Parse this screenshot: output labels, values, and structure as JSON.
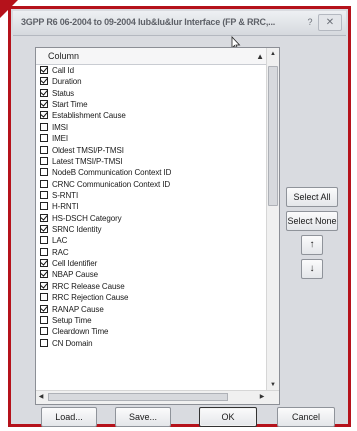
{
  "dialog": {
    "title": "3GPP R6 06-2004 to 09-2004 Iub&Iu&Iur Interface (FP & RRC,...",
    "help_label": "?",
    "close_label": "✕"
  },
  "list": {
    "column_header": "Column",
    "rows": [
      {
        "label": "Call Id",
        "checked": true
      },
      {
        "label": "Duration",
        "checked": true
      },
      {
        "label": "Status",
        "checked": true
      },
      {
        "label": "Start Time",
        "checked": true
      },
      {
        "label": "Establishment Cause",
        "checked": true
      },
      {
        "label": "IMSI",
        "checked": false
      },
      {
        "label": "IMEI",
        "checked": false
      },
      {
        "label": "Oldest TMSI/P-TMSI",
        "checked": false
      },
      {
        "label": "Latest TMSI/P-TMSI",
        "checked": false
      },
      {
        "label": "NodeB Communication Context ID",
        "checked": false
      },
      {
        "label": "CRNC Communication Context ID",
        "checked": false
      },
      {
        "label": "S-RNTI",
        "checked": false
      },
      {
        "label": "H-RNTI",
        "checked": false
      },
      {
        "label": "HS-DSCH Category",
        "checked": true
      },
      {
        "label": "SRNC Identity",
        "checked": true
      },
      {
        "label": "LAC",
        "checked": false
      },
      {
        "label": "RAC",
        "checked": false
      },
      {
        "label": "Cell Identifier",
        "checked": true
      },
      {
        "label": "NBAP Cause",
        "checked": true
      },
      {
        "label": "RRC Release Cause",
        "checked": true
      },
      {
        "label": "RRC Rejection Cause",
        "checked": false
      },
      {
        "label": "RANAP Cause",
        "checked": true
      },
      {
        "label": "Setup Time",
        "checked": false
      },
      {
        "label": "Cleardown Time",
        "checked": false
      },
      {
        "label": "CN Domain",
        "checked": false
      }
    ]
  },
  "side_buttons": {
    "select_all": "Select All",
    "select_none": "Select None",
    "move_up": "↑",
    "move_down": "↓"
  },
  "bottom_buttons": {
    "load": "Load...",
    "save": "Save...",
    "ok": "OK",
    "cancel": "Cancel"
  },
  "colors": {
    "highlight_border": "#b5121b"
  }
}
